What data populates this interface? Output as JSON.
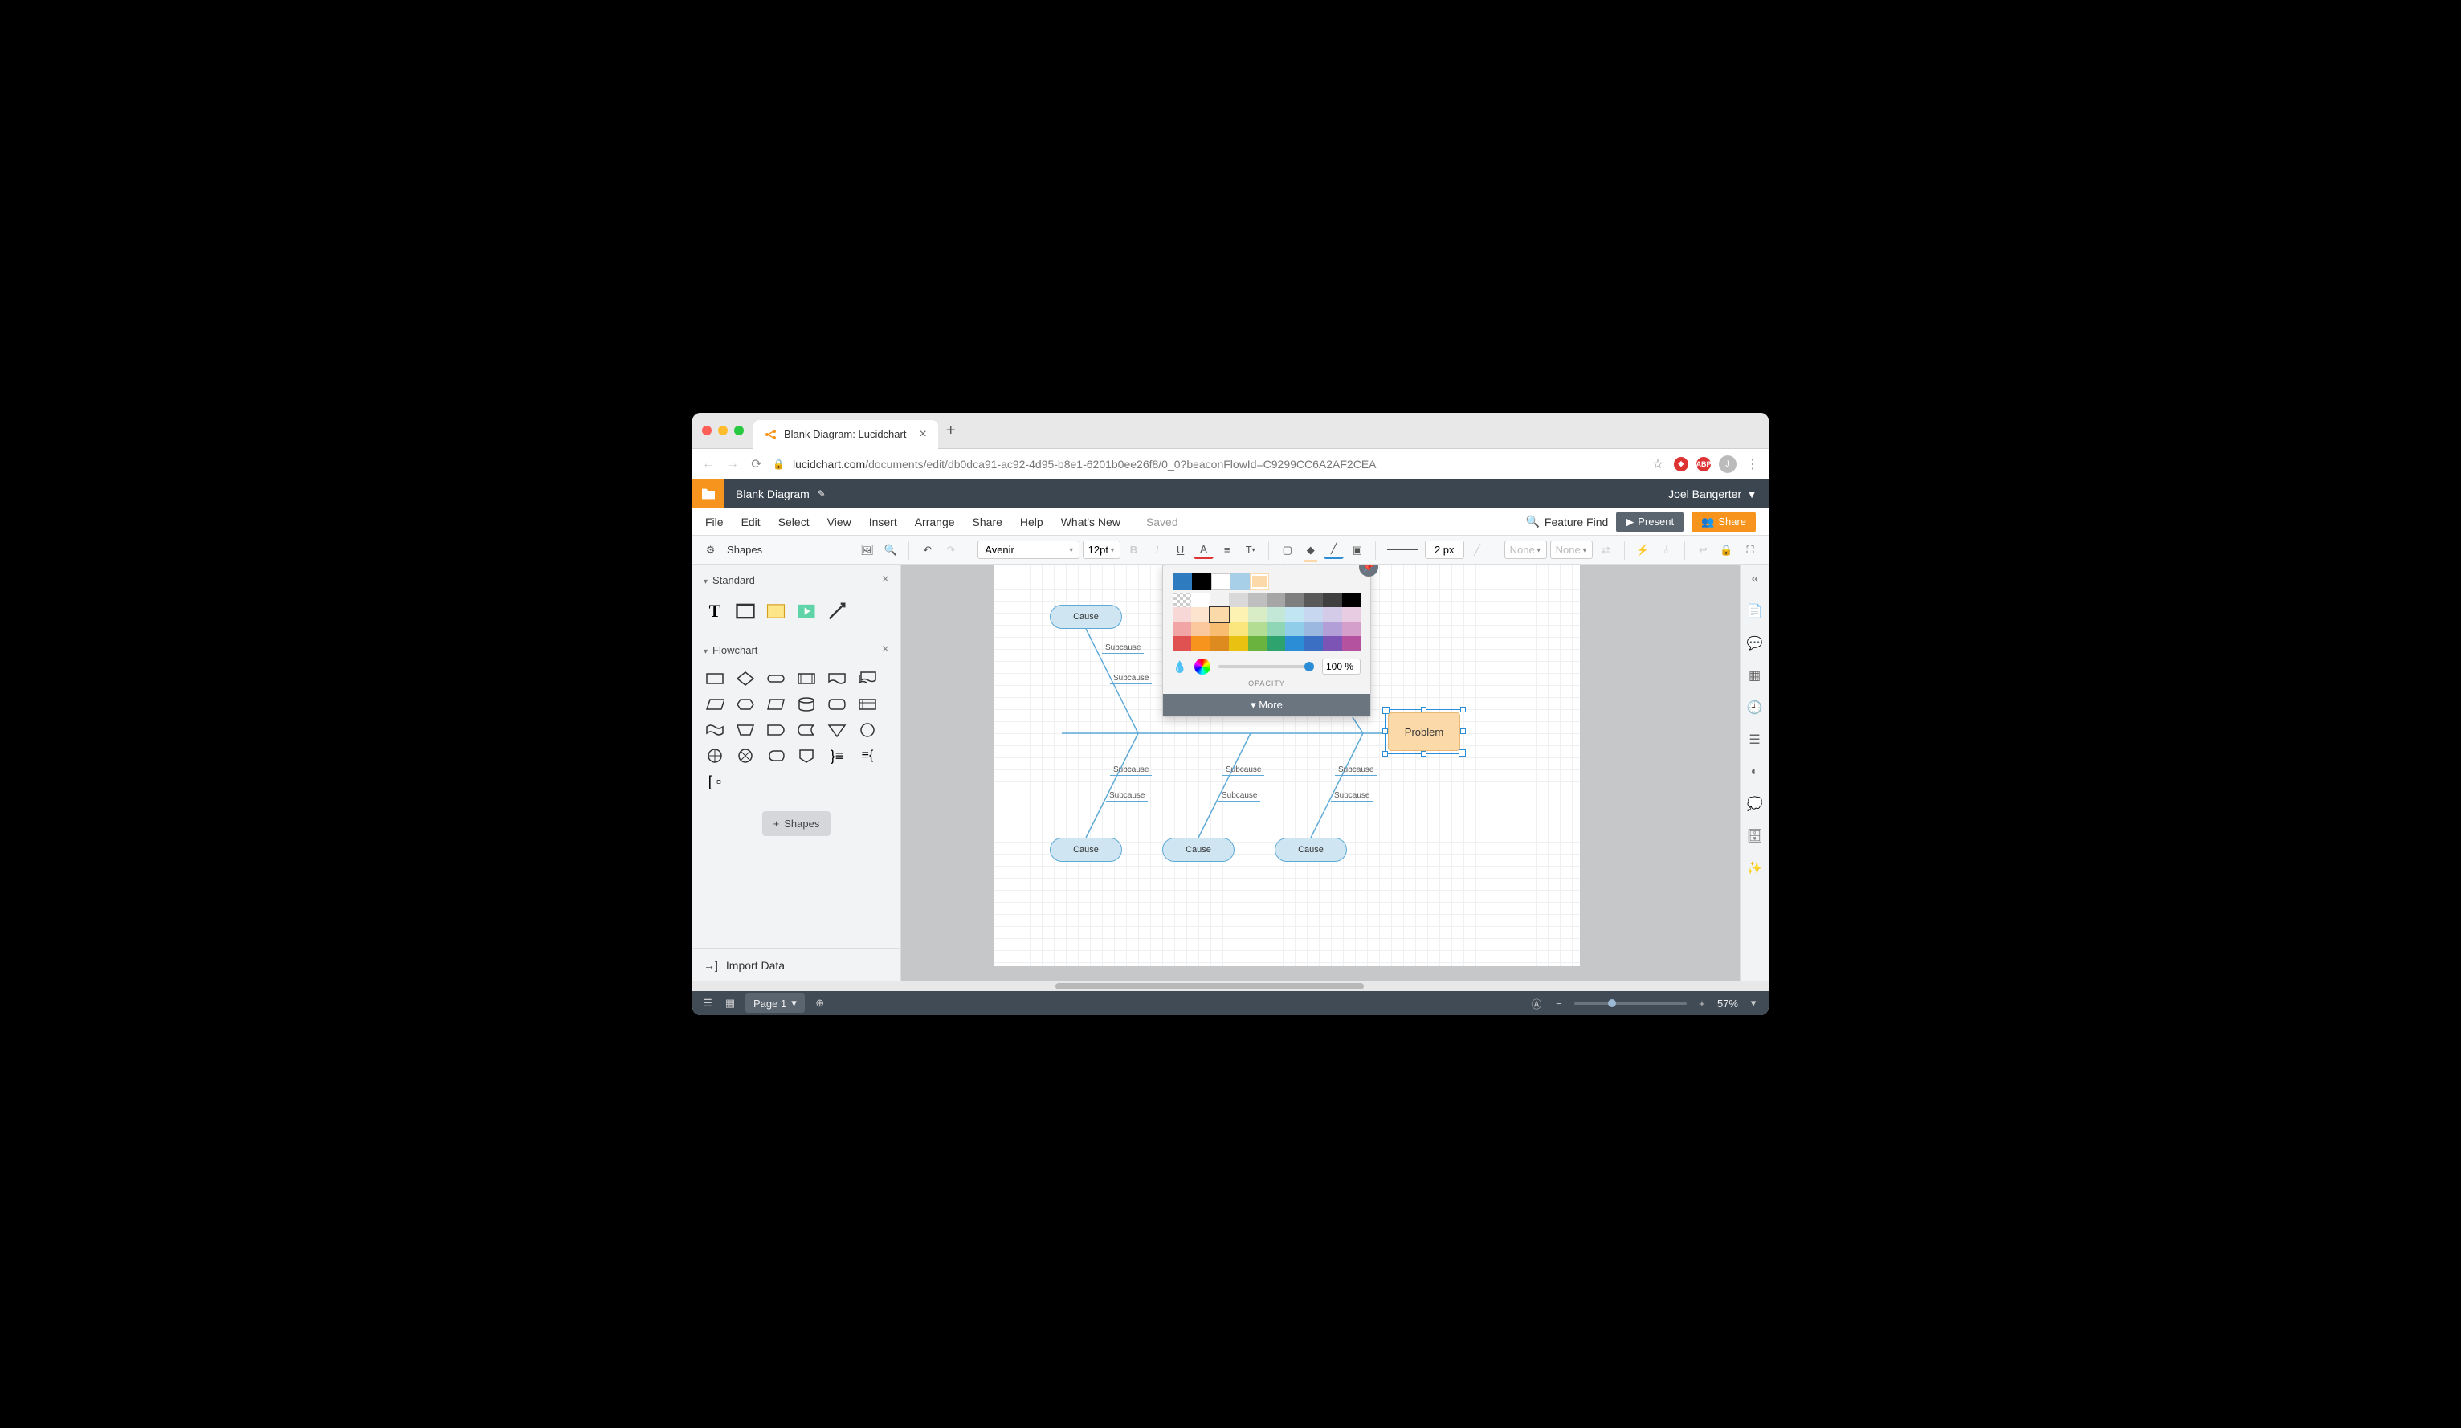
{
  "browser": {
    "tab_icon_color": "#f7941d",
    "tab_title": "Blank Diagram: Lucidchart",
    "new_tab": "+",
    "url_host": "lucidchart.com",
    "url_path": "/documents/edit/db0dca91-ac92-4d95-b8e1-6201b0ee26f8/0_0?beaconFlowId=C9299CC6A2AF2CEA",
    "avatar_initial": "J"
  },
  "header": {
    "doc_title": "Blank Diagram",
    "user_name": "Joel Bangerter"
  },
  "menu": {
    "items": [
      "File",
      "Edit",
      "Select",
      "View",
      "Insert",
      "Arrange",
      "Share",
      "Help",
      "What's New"
    ],
    "saved": "Saved",
    "feature_find": "Feature Find",
    "present": "Present",
    "share": "Share"
  },
  "toolbar": {
    "shapes_label": "Shapes",
    "font": "Avenir",
    "font_size": "12pt",
    "line_width": "2 px",
    "effect1": "None",
    "effect2": "None"
  },
  "left": {
    "standard": "Standard",
    "flowchart": "Flowchart",
    "add_shapes": "Shapes",
    "import": "Import Data"
  },
  "diagram": {
    "cause": "Cause",
    "subcause": "Subcause",
    "problem": "Problem"
  },
  "picker": {
    "recent": [
      "#2f7bbf",
      "#000000",
      "#ffffff",
      "#a7cfe8",
      "#fcd9a8"
    ],
    "opacity": "100 %",
    "opacity_label": "OPACITY",
    "more": "More",
    "palette": [
      [
        "trans",
        "#ffffff",
        "#f2f2f2",
        "#d9d9d9",
        "#bfbfbf",
        "#a6a6a6",
        "#7f7f7f",
        "#595959",
        "#3f3f3f",
        "#000000"
      ],
      [
        "#f8d7d7",
        "#fde4cf",
        "#fcd9a8",
        "#fdf2b2",
        "#d8ecc5",
        "#c3e8d7",
        "#c2e5f4",
        "#c7d7ef",
        "#d4cbe9",
        "#e8cde2"
      ],
      [
        "#f1a5a5",
        "#fbc89d",
        "#f9bd72",
        "#fbe57d",
        "#b3dd92",
        "#8fd6b6",
        "#8fcde9",
        "#9ab8e0",
        "#b29fd7",
        "#d4a0cb"
      ],
      [
        "#e05252",
        "#f7941d",
        "#dd8b1e",
        "#e9c211",
        "#6ab33e",
        "#2fa36e",
        "#2a8dd6",
        "#3b6fc4",
        "#7b54b6",
        "#b452a0"
      ]
    ]
  },
  "status": {
    "page": "Page 1",
    "zoom": "57%"
  }
}
